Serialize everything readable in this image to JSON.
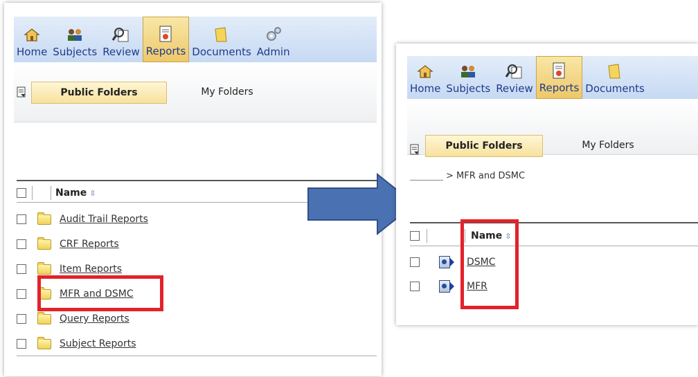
{
  "nav": {
    "items_left": [
      {
        "label": "Home",
        "icon": "home-icon"
      },
      {
        "label": "Subjects",
        "icon": "subjects-icon"
      },
      {
        "label": "Review",
        "icon": "review-icon"
      },
      {
        "label": "Reports",
        "icon": "reports-icon",
        "active": true
      },
      {
        "label": "Documents",
        "icon": "documents-icon"
      },
      {
        "label": "Admin",
        "icon": "admin-icon"
      }
    ],
    "items_right": [
      {
        "label": "Home"
      },
      {
        "label": "Subjects"
      },
      {
        "label": "Review"
      },
      {
        "label": "Reports",
        "active": true
      },
      {
        "label": "Documents"
      }
    ]
  },
  "folder_tabs": {
    "public": "Public Folders",
    "my": "My Folders"
  },
  "left_table": {
    "name_header": "Name",
    "rows": [
      "Audit Trail Reports",
      "CRF Reports",
      "Item Reports",
      "MFR and DSMC",
      "Query Reports",
      "Subject Reports"
    ],
    "highlighted_row": "MFR and DSMC"
  },
  "right_view": {
    "breadcrumb": "> MFR and DSMC",
    "name_header": "Name",
    "rows": [
      "DSMC",
      "MFR"
    ]
  },
  "colors": {
    "highlight": "#e3222a",
    "arrow_fill": "#4a72b2",
    "nav_text": "#1f3a8a"
  }
}
